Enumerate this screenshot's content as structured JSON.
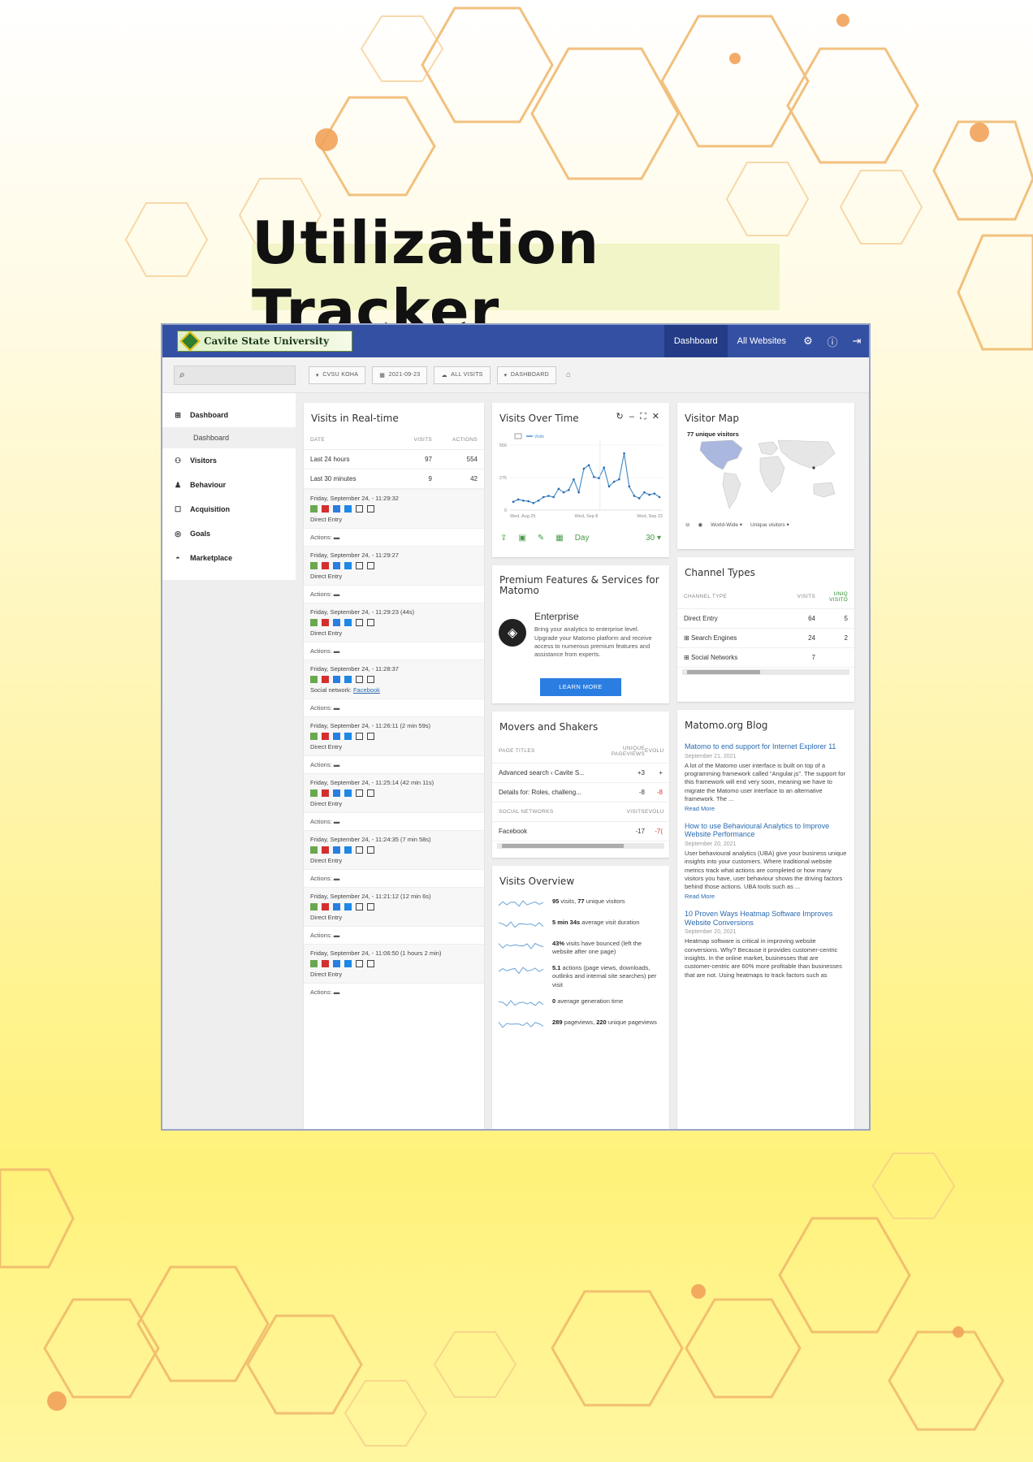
{
  "poster": {
    "title": "Utilization Tracker"
  },
  "colors": {
    "header_blue": "#3450a3",
    "accent_green": "#4a9b4a",
    "link_blue": "#2a6ab0",
    "button_blue": "#2a7de1"
  },
  "header": {
    "logo_text": "Cavite State University",
    "nav": [
      "Dashboard",
      "All Websites"
    ],
    "icons": [
      "gear-icon",
      "info-icon",
      "logout-icon"
    ]
  },
  "toolbar": {
    "search_icon": "search-icon",
    "site": "CVSU KOHA",
    "date": "2021-09-23",
    "segment": "ALL VISITS",
    "dashboard": "DASHBOARD"
  },
  "sidebar": {
    "items": [
      {
        "label": "Dashboard",
        "icon": "grid-icon"
      },
      {
        "label": "Visitors",
        "icon": "visitors-icon"
      },
      {
        "label": "Behaviour",
        "icon": "bell-icon"
      },
      {
        "label": "Acquisition",
        "icon": "square-icon"
      },
      {
        "label": "Goals",
        "icon": "target-icon"
      },
      {
        "label": "Marketplace",
        "icon": "marketplace-icon"
      }
    ],
    "sub_item": "Dashboard"
  },
  "realtime": {
    "title": "Visits in Real-time",
    "headers": [
      "DATE",
      "VISITS",
      "ACTIONS"
    ],
    "rows": [
      {
        "date": "Last 24 hours",
        "visits": "97",
        "actions": "554"
      },
      {
        "date": "Last 30 minutes",
        "visits": "9",
        "actions": "42"
      }
    ],
    "actions_label": "Actions:",
    "entries": [
      {
        "time": "Friday, September 24, - 11:29:32",
        "source": "Direct Entry"
      },
      {
        "time": "Friday, September 24, - 11:29:27",
        "source": "Direct Entry"
      },
      {
        "time": "Friday, September 24, - 11:29:23 (44s)",
        "source": "Direct Entry"
      },
      {
        "time": "Friday, September 24, - 11:28:37",
        "source": "Social network:",
        "link": "Facebook"
      },
      {
        "time": "Friday, September 24, - 11:26:11 (2 min 59s)",
        "source": "Direct Entry"
      },
      {
        "time": "Friday, September 24, - 11:25:14 (42 min 11s)",
        "source": "Direct Entry"
      },
      {
        "time": "Friday, September 24, - 11:24:35 (7 min 58s)",
        "source": "Direct Entry"
      },
      {
        "time": "Friday, September 24, - 11:21:12 (12 min 6s)",
        "source": "Direct Entry"
      },
      {
        "time": "Friday, September 24, - 11:06:50 (1 hours 2 min)",
        "source": "Direct Entry"
      }
    ]
  },
  "visits_over_time": {
    "title": "Visits Over Time",
    "legend": "Visits",
    "yticks": [
      "550",
      "275",
      "0"
    ],
    "xticks": [
      "Wed, Aug 25",
      "Wed, Sep 8",
      "Wed, Sep 22"
    ],
    "period": "Day",
    "range": "30"
  },
  "chart_data": {
    "type": "line",
    "title": "Visits Over Time",
    "series": [
      {
        "name": "Visits",
        "values": [
          70,
          90,
          80,
          75,
          60,
          80,
          110,
          120,
          110,
          180,
          150,
          170,
          260,
          150,
          350,
          380,
          280,
          270,
          360,
          200,
          240,
          260,
          480,
          200,
          120,
          100,
          150,
          130,
          140,
          110
        ]
      }
    ],
    "x_start": "Wed, Aug 25",
    "x_end": "Wed, Sep 22",
    "ylim": [
      0,
      550
    ]
  },
  "premium": {
    "title": "Premium Features & Services for Matomo",
    "heading": "Enterprise",
    "text": "Bring your analytics to enterprise level. Upgrade your Matomo platform and receive access to numerous premium features and assistance from experts.",
    "button": "LEARN MORE"
  },
  "movers": {
    "title": "Movers and Shakers",
    "headers1": [
      "PAGE TITLES",
      "UNIQUE PAGEVIEWS",
      "EVOLU"
    ],
    "rows1": [
      {
        "name": "Advanced search ‹ Cavite S...",
        "value": "+3",
        "evo": "+"
      },
      {
        "name": "Details for: Roles, challeng...",
        "value": "-8",
        "evo": "-8"
      }
    ],
    "headers2": [
      "SOCIAL NETWORKS",
      "VISITS",
      "EVOLU"
    ],
    "rows2": [
      {
        "name": "Facebook",
        "value": "-17",
        "evo": "-7("
      }
    ]
  },
  "overview": {
    "title": "Visits Overview",
    "items": [
      {
        "strong": "95",
        "text": " visits, ",
        "strong2": "77",
        "text2": " unique visitors"
      },
      {
        "strong": "5 min 34s",
        "text": " average visit duration",
        "strong2": "",
        "text2": ""
      },
      {
        "strong": "43%",
        "text": " visits have bounced (left the website after one page)",
        "strong2": "",
        "text2": ""
      },
      {
        "strong": "5.1",
        "text": " actions (page views, downloads, outlinks and internal site searches) per visit",
        "strong2": "",
        "text2": ""
      },
      {
        "strong": "0",
        "text": " average generation time",
        "strong2": "",
        "text2": ""
      },
      {
        "strong": "289",
        "text": " pageviews, ",
        "strong2": "220",
        "text2": " unique pageviews"
      }
    ]
  },
  "visitor_map": {
    "title": "Visitor Map",
    "label": "77 unique visitors",
    "region": "World-Wide",
    "metric": "Unique visitors"
  },
  "channels": {
    "title": "Channel Types",
    "headers": [
      "CHANNEL TYPE",
      "VISITS",
      "UNIQ VISITO"
    ],
    "rows": [
      {
        "name": "Direct Entry",
        "visits": "64",
        "uniq": "5"
      },
      {
        "name": "Search Engines",
        "visits": "24",
        "uniq": "2"
      },
      {
        "name": "Social Networks",
        "visits": "7",
        "uniq": ""
      }
    ]
  },
  "blog": {
    "title": "Matomo.org Blog",
    "posts": [
      {
        "title": "Matomo to end support for Internet Explorer 11",
        "date": "September 21, 2021",
        "text": "A lot of the Matomo user interface is built on top of a programming framework called “Angular.js”. The support for this framework will end very soon, meaning we have to migrate the Matomo user interface to an alternative framework. The ...",
        "more": "Read More"
      },
      {
        "title": "How to use Behavioural Analytics to Improve Website Performance",
        "date": "September 20, 2021",
        "text": "User behavioural analytics (UBA) give your business unique insights into your customers. Where traditional website metrics track what actions are completed or how many visitors you have, user behaviour shows the driving factors behind those actions. UBA tools such as ...",
        "more": "Read More"
      },
      {
        "title": "10 Proven Ways Heatmap Software Improves Website Conversions",
        "date": "September 20, 2021",
        "text": "Heatmap software is critical in improving website conversions. Why? Because it provides customer-centric insights. In the online market, businesses that are customer-centric are 60% more profitable than businesses that are not. Using heatmaps to track factors such as",
        "more": ""
      }
    ]
  }
}
